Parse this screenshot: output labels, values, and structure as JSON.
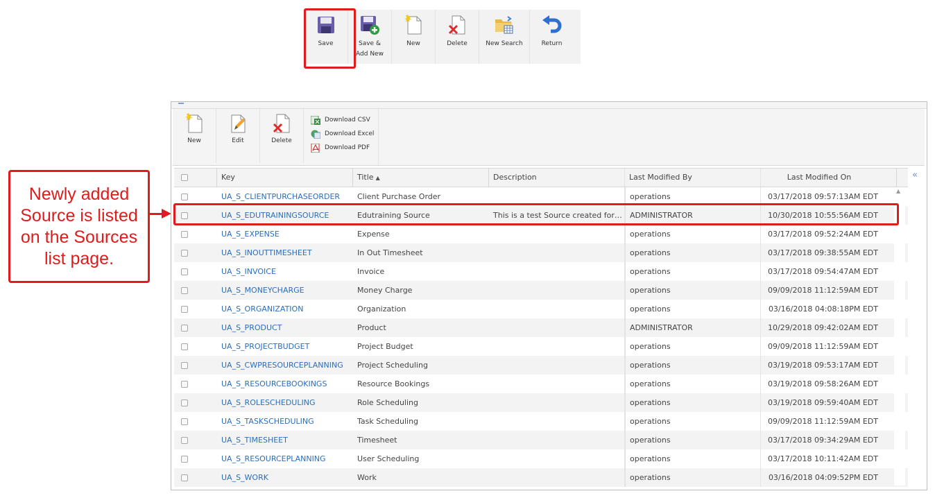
{
  "top_toolbar": {
    "buttons": [
      {
        "label": "Save",
        "icon": "save-icon"
      },
      {
        "label_line1": "Save &",
        "label_line2": "Add New",
        "icon": "save-add-new-icon"
      },
      {
        "label": "New",
        "icon": "new-document-icon"
      },
      {
        "label": "Delete",
        "icon": "delete-document-icon"
      },
      {
        "label": "New Search",
        "icon": "folder-search-icon"
      },
      {
        "label": "Return",
        "icon": "return-arrow-icon"
      }
    ]
  },
  "callout": {
    "text": "Newly added Source is listed on the Sources list page.",
    "color": "#e01b1b"
  },
  "list_toolbar": {
    "new_label": "New",
    "edit_label": "Edit",
    "delete_label": "Delete",
    "download_csv": "Download CSV",
    "download_excel": "Download Excel",
    "download_pdf": "Download PDF"
  },
  "grid": {
    "columns": {
      "key": "Key",
      "title": "Title",
      "description": "Description",
      "last_modified_by": "Last Modified By",
      "last_modified_on": "Last Modified On"
    },
    "sort_indicator": "▲",
    "collapse_icon": "«",
    "rows": [
      {
        "key": "UA_S_CLIENTPURCHASEORDER",
        "title": "Client Purchase Order",
        "description": "",
        "by": "operations",
        "on": "03/17/2018 09:57:13AM EDT"
      },
      {
        "key": "UA_S_EDUTRAININGSOURCE",
        "title": "Edutraining Source",
        "description": "This is a test Source created for th…",
        "by": "ADMINISTRATOR",
        "on": "10/30/2018 10:55:56AM EDT"
      },
      {
        "key": "UA_S_EXPENSE",
        "title": "Expense",
        "description": "",
        "by": "operations",
        "on": "03/17/2018 09:52:24AM EDT"
      },
      {
        "key": "UA_S_INOUTTIMESHEET",
        "title": "In Out Timesheet",
        "description": "",
        "by": "operations",
        "on": "03/17/2018 09:38:55AM EDT"
      },
      {
        "key": "UA_S_INVOICE",
        "title": "Invoice",
        "description": "",
        "by": "operations",
        "on": "03/17/2018 09:54:47AM EDT"
      },
      {
        "key": "UA_S_MONEYCHARGE",
        "title": "Money Charge",
        "description": "",
        "by": "operations",
        "on": "09/09/2018 11:12:59AM EDT"
      },
      {
        "key": "UA_S_ORGANIZATION",
        "title": "Organization",
        "description": "",
        "by": "operations",
        "on": "03/16/2018 04:08:18PM EDT"
      },
      {
        "key": "UA_S_PRODUCT",
        "title": "Product",
        "description": "",
        "by": "ADMINISTRATOR",
        "on": "10/29/2018 09:42:02AM EDT"
      },
      {
        "key": "UA_S_PROJECTBUDGET",
        "title": "Project Budget",
        "description": "",
        "by": "operations",
        "on": "09/09/2018 11:12:59AM EDT"
      },
      {
        "key": "UA_S_CWPRESOURCEPLANNING",
        "title": "Project Scheduling",
        "description": "",
        "by": "operations",
        "on": "03/19/2018 09:53:17AM EDT"
      },
      {
        "key": "UA_S_RESOURCEBOOKINGS",
        "title": "Resource Bookings",
        "description": "",
        "by": "operations",
        "on": "03/19/2018 09:58:26AM EDT"
      },
      {
        "key": "UA_S_ROLESCHEDULING",
        "title": "Role Scheduling",
        "description": "",
        "by": "operations",
        "on": "03/19/2018 09:59:40AM EDT"
      },
      {
        "key": "UA_S_TASKSCHEDULING",
        "title": "Task Scheduling",
        "description": "",
        "by": "operations",
        "on": "09/09/2018 11:12:59AM EDT"
      },
      {
        "key": "UA_S_TIMESHEET",
        "title": "Timesheet",
        "description": "",
        "by": "operations",
        "on": "03/17/2018 09:34:29AM EDT"
      },
      {
        "key": "UA_S_RESOURCEPLANNING",
        "title": "User Scheduling",
        "description": "",
        "by": "operations",
        "on": "03/17/2018 10:11:42AM EDT"
      },
      {
        "key": "UA_S_WORK",
        "title": "Work",
        "description": "",
        "by": "operations",
        "on": "03/16/2018 04:09:52PM EDT"
      }
    ]
  }
}
